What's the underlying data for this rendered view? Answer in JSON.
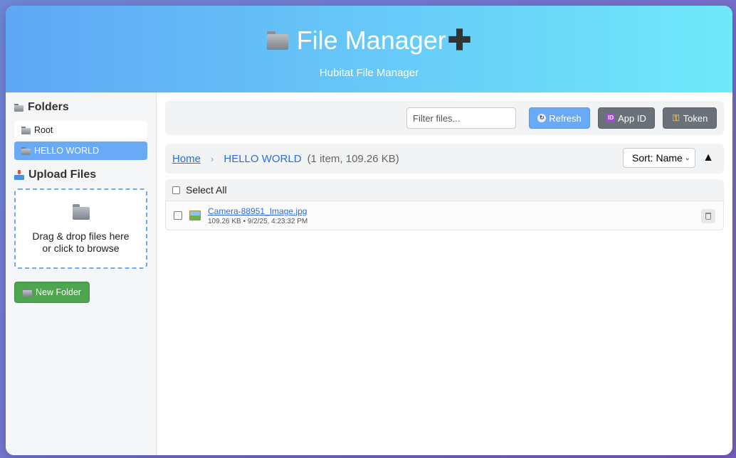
{
  "header": {
    "title": "File Manager",
    "subtitle": "Hubitat File Manager"
  },
  "sidebar": {
    "folders_heading": "Folders",
    "folders": [
      {
        "label": "Root",
        "active": false
      },
      {
        "label": "HELLO WORLD",
        "active": true
      }
    ],
    "upload_heading": "Upload Files",
    "dropzone_line1": "Drag & drop files here",
    "dropzone_line2": "or click to browse",
    "new_folder_label": "New Folder"
  },
  "toolbar": {
    "filter_placeholder": "Filter files...",
    "refresh_label": "Refresh",
    "appid_label": "App ID",
    "token_label": "Token"
  },
  "breadcrumb": {
    "home": "Home",
    "separator": "›",
    "current": "HELLO WORLD",
    "info": "(1 item, 109.26 KB)"
  },
  "sort": {
    "selected": "Sort: Name",
    "direction": "▲"
  },
  "list": {
    "select_all_label": "Select All",
    "files": [
      {
        "name": "Camera-88951_Image.jpg",
        "meta": "109.26 KB • 9/2/25, 4:23:32 PM"
      }
    ]
  },
  "colors": {
    "accent": "#6aa9f5",
    "header_start": "#5fa7f5",
    "header_end": "#6fe9fa",
    "new_folder": "#4da64d",
    "gray_button": "#6b7178"
  }
}
